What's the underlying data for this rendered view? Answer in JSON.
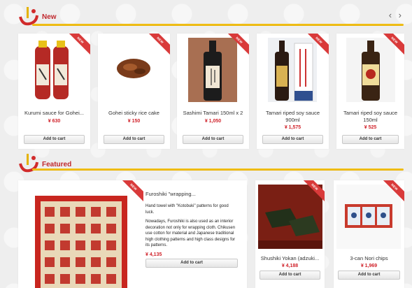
{
  "sections": {
    "new": {
      "title": "New"
    },
    "featured": {
      "title": "Featured"
    }
  },
  "nav": {
    "prev": "‹",
    "next": "›"
  },
  "badge": "NEW",
  "new_products": [
    {
      "name": "Kurumi sauce for Gohei...",
      "price": "¥ 630",
      "cart": "Add to cart"
    },
    {
      "name": "Gohei sticky rice cake",
      "price": "¥ 150",
      "cart": "Add to cart"
    },
    {
      "name": "Sashimi Tamari 150ml x 2",
      "price": "¥ 1,050",
      "cart": "Add to cart"
    },
    {
      "name": "Tamari riped soy sauce 900ml",
      "price": "¥ 1,575",
      "cart": "Add to cart"
    },
    {
      "name": "Tamari riped soy sauce 150ml",
      "price": "¥ 525",
      "cart": "Add to cart"
    }
  ],
  "featured_main": {
    "name": "Furoshiki \"wrapping...",
    "desc1": "Hand towel with \"Kotobuki\" patterns for good luck.",
    "desc2": "Nowadays, Furoshiki is also used as an interior decoration not only for wrapping cloth. Chikusen use cotton for material and Japanese traditional high clothing patterns and high class designs for its patterns.",
    "price": "¥ 4,135",
    "cart": "Add to cart"
  },
  "featured_products": [
    {
      "name": "Shushiki Yokan (adzuki...",
      "price": "¥ 4,188",
      "cart": "Add to cart"
    },
    {
      "name": "3-can Nori chips",
      "price": "¥ 1,969",
      "cart": "Add to cart"
    }
  ],
  "colors": {
    "accent": "#c0282d",
    "rule": "#f3c623",
    "ribbon": "#d93a3a"
  }
}
